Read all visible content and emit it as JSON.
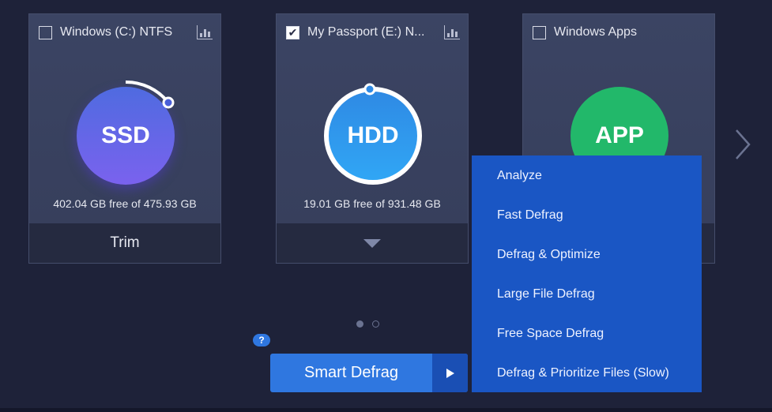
{
  "drives": [
    {
      "label": "Windows (C:) NTFS",
      "checked": false,
      "type": "SSD",
      "free": "402.04 GB free of 475.93 GB",
      "action": "Trim"
    },
    {
      "label": "My Passport (E:) N...",
      "checked": true,
      "type": "HDD",
      "free": "19.01 GB free of 931.48 GB"
    },
    {
      "label": "Windows Apps",
      "checked": false,
      "type": "APP"
    }
  ],
  "menu": [
    "Analyze",
    "Fast Defrag",
    "Defrag & Optimize",
    "Large File Defrag",
    "Free Space Defrag",
    "Defrag & Prioritize Files (Slow)"
  ],
  "primary_button": "Smart Defrag",
  "help": "?",
  "colors": {
    "ssd": "#6a62e8",
    "hdd": "#2e95ec",
    "app": "#22b86a",
    "menu": "#1a56c4",
    "button": "#2f77e0"
  }
}
